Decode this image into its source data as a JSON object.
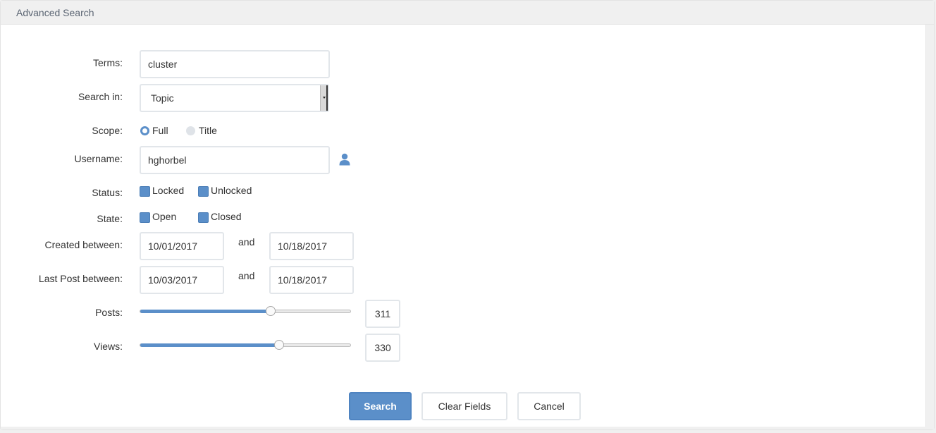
{
  "panel": {
    "title": "Advanced Search"
  },
  "form": {
    "terms": {
      "label": "Terms:",
      "value": "cluster"
    },
    "search_in": {
      "label": "Search in:",
      "value": "Topic"
    },
    "scope": {
      "label": "Scope:",
      "options": [
        "Full",
        "Title"
      ],
      "selected": "Full"
    },
    "username": {
      "label": "Username:",
      "value": "hghorbel",
      "icon": "user-icon"
    },
    "status": {
      "label": "Status:",
      "options": [
        "Locked",
        "Unlocked"
      ],
      "checked": [
        "Locked",
        "Unlocked"
      ]
    },
    "state": {
      "label": "State:",
      "options": [
        "Open",
        "Closed"
      ],
      "checked": [
        "Open",
        "Closed"
      ]
    },
    "created": {
      "label": "Created between:",
      "from": "10/01/2017",
      "and": "and",
      "to": "10/18/2017"
    },
    "last_post": {
      "label": "Last Post between:",
      "from": "10/03/2017",
      "and": "and",
      "to": "10/18/2017"
    },
    "posts": {
      "label": "Posts:",
      "value": "311",
      "fraction": 0.62
    },
    "views": {
      "label": "Views:",
      "value": "330",
      "fraction": 0.66
    }
  },
  "buttons": {
    "search": "Search",
    "clear": "Clear Fields",
    "cancel": "Cancel"
  },
  "colors": {
    "accent": "#5b8fc9",
    "header_bg": "#f0f0f0"
  }
}
